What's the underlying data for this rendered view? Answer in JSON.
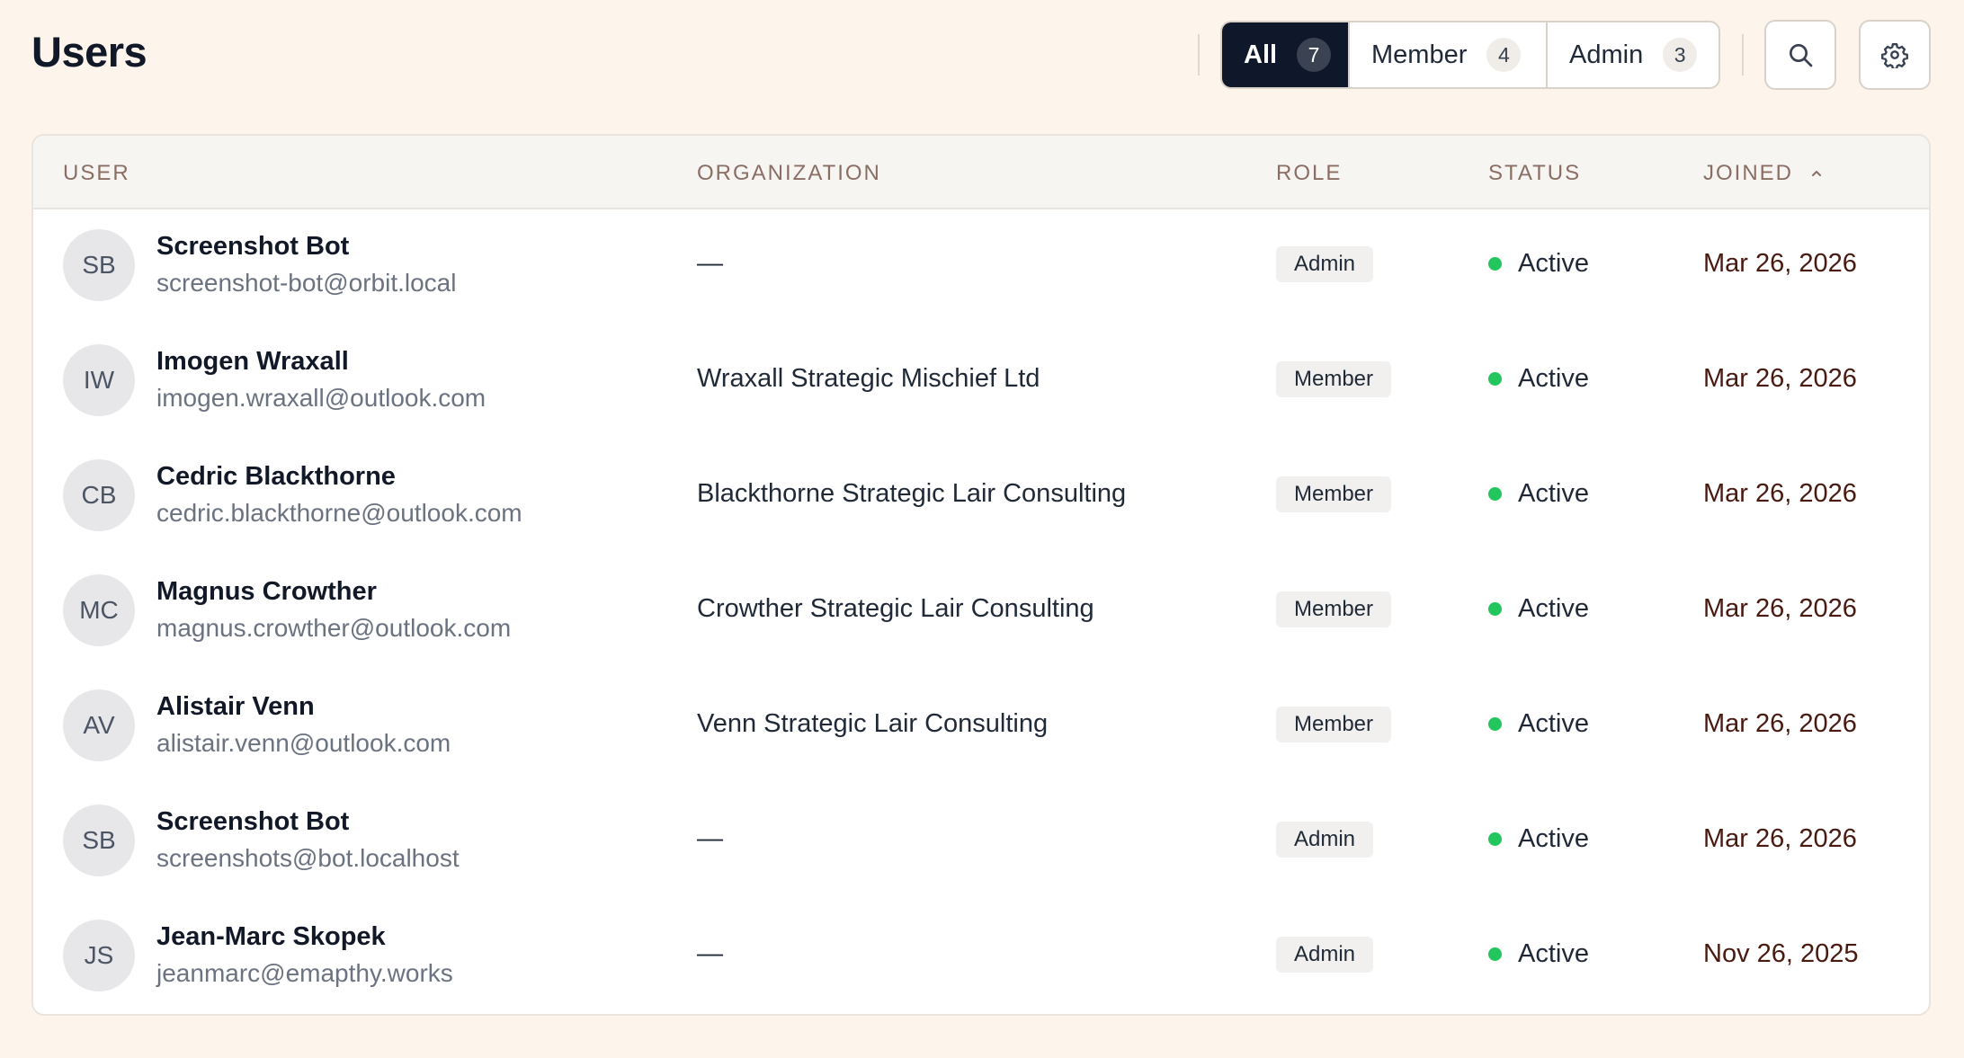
{
  "page": {
    "title": "Users"
  },
  "filters": [
    {
      "label": "All",
      "count": "7",
      "active": true
    },
    {
      "label": "Member",
      "count": "4",
      "active": false
    },
    {
      "label": "Admin",
      "count": "3",
      "active": false
    }
  ],
  "toolbar": {
    "search_icon": "search-icon",
    "settings_icon": "gear-icon"
  },
  "table": {
    "columns": {
      "user": "USER",
      "organization": "ORGANIZATION",
      "role": "ROLE",
      "status": "STATUS",
      "joined": "JOINED"
    },
    "sort_icon": "chevron-up-icon",
    "rows": [
      {
        "initials": "SB",
        "name": "Screenshot Bot",
        "email": "screenshot-bot@orbit.local",
        "organization": "—",
        "role": "Admin",
        "status": "Active",
        "joined": "Mar 26, 2026"
      },
      {
        "initials": "IW",
        "name": "Imogen Wraxall",
        "email": "imogen.wraxall@outlook.com",
        "organization": "Wraxall Strategic Mischief Ltd",
        "role": "Member",
        "status": "Active",
        "joined": "Mar 26, 2026"
      },
      {
        "initials": "CB",
        "name": "Cedric Blackthorne",
        "email": "cedric.blackthorne@outlook.com",
        "organization": "Blackthorne Strategic Lair Consulting",
        "role": "Member",
        "status": "Active",
        "joined": "Mar 26, 2026"
      },
      {
        "initials": "MC",
        "name": "Magnus Crowther",
        "email": "magnus.crowther@outlook.com",
        "organization": "Crowther Strategic Lair Consulting",
        "role": "Member",
        "status": "Active",
        "joined": "Mar 26, 2026"
      },
      {
        "initials": "AV",
        "name": "Alistair Venn",
        "email": "alistair.venn@outlook.com",
        "organization": "Venn Strategic Lair Consulting",
        "role": "Member",
        "status": "Active",
        "joined": "Mar 26, 2026"
      },
      {
        "initials": "SB",
        "name": "Screenshot Bot",
        "email": "screenshots@bot.localhost",
        "organization": "—",
        "role": "Admin",
        "status": "Active",
        "joined": "Mar 26, 2026"
      },
      {
        "initials": "JS",
        "name": "Jean-Marc Skopek",
        "email": "jeanmarc@emapthy.works",
        "organization": "—",
        "role": "Admin",
        "status": "Active",
        "joined": "Nov 26, 2025"
      }
    ]
  },
  "colors": {
    "page_bg": "#fdf5ec",
    "active_filter_bg": "#0f172a",
    "status_active": "#22c55e",
    "joined_text": "#4a1a10",
    "header_text": "#8a6e64"
  }
}
